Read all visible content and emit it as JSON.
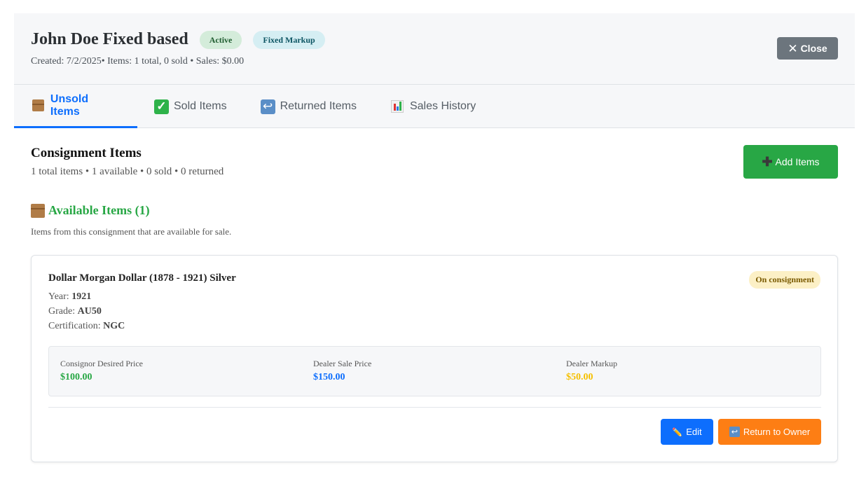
{
  "header": {
    "title": "John Doe Fixed based",
    "badges": [
      "Active",
      "Fixed Markup"
    ],
    "meta": "Created: 7/2/2025• Items: 1 total, 0 sold • Sales: $0.00",
    "close_label": "Close"
  },
  "tabs": [
    {
      "label": "Unsold Items",
      "icon": "package-icon",
      "active": true
    },
    {
      "label": "Sold Items",
      "icon": "check-icon",
      "active": false
    },
    {
      "label": "Returned Items",
      "icon": "return-icon",
      "active": false
    },
    {
      "label": "Sales History",
      "icon": "chart-icon",
      "active": false
    }
  ],
  "section": {
    "title": "Consignment Items",
    "subtitle": "1 total items • 1 available • 0 sold • 0 returned",
    "add_label": "Add Items"
  },
  "available": {
    "title": "Available Items (1)",
    "subtitle": "Items from this consignment that are available for sale."
  },
  "item": {
    "name": "Dollar Morgan Dollar (1878 - 1921) Silver",
    "status": "On consignment",
    "year_label": "Year:",
    "year": "1921",
    "grade_label": "Grade:",
    "grade": "AU50",
    "cert_label": "Certification:",
    "cert": "NGC",
    "prices": [
      {
        "label": "Consignor Desired Price",
        "value": "$100.00",
        "color": "#28a745"
      },
      {
        "label": "Dealer Sale Price",
        "value": "$150.00",
        "color": "#0d6efd"
      },
      {
        "label": "Dealer Markup",
        "value": "$50.00",
        "color": "#f5c000"
      }
    ],
    "edit_label": "Edit",
    "return_label": "Return to Owner"
  }
}
